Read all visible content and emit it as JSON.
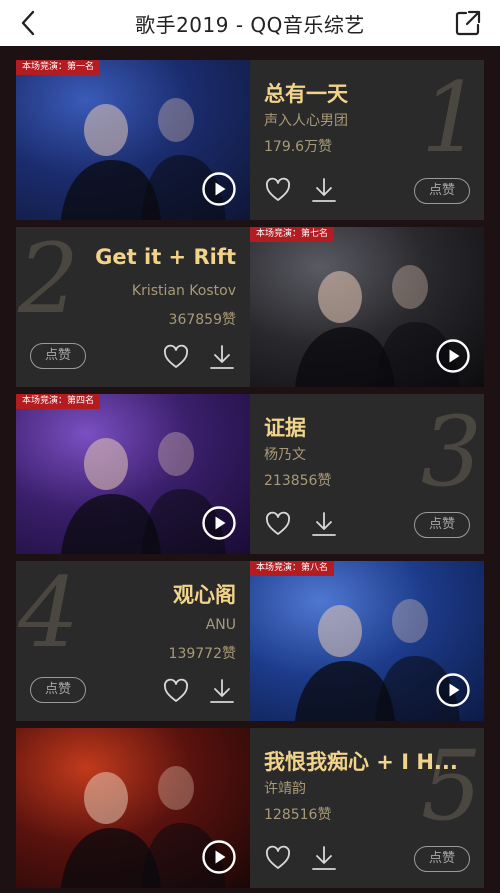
{
  "header": {
    "title": "歌手2019 - QQ音乐综艺"
  },
  "cards": [
    {
      "rank": "1",
      "song": "总有一天",
      "artist": "声入人心男团",
      "likes": "179.6万赞",
      "tag": "本场竞演：第一名",
      "layout": "left-photo",
      "colors": [
        "#1b2c6e",
        "#0e1636",
        "#3a5bb8"
      ]
    },
    {
      "rank": "2",
      "song": "Get it + Rift",
      "artist": "Kristian Kostov",
      "likes": "367859赞",
      "tag": "本场竞演：第七名",
      "layout": "right-photo",
      "colors": [
        "#2a2a2e",
        "#0c0c0f",
        "#5a5a63"
      ]
    },
    {
      "rank": "3",
      "song": "证据",
      "artist": "杨乃文",
      "likes": "213856赞",
      "tag": "本场竞演：第四名",
      "layout": "left-photo",
      "colors": [
        "#3a1f6b",
        "#190b35",
        "#7b4fc2"
      ]
    },
    {
      "rank": "4",
      "song": "观心阁",
      "artist": "ANU",
      "likes": "139772赞",
      "tag": "本场竞演：第八名",
      "layout": "right-photo",
      "colors": [
        "#1d3b8a",
        "#0c1a45",
        "#4f78d2"
      ]
    },
    {
      "rank": "5",
      "song": "我恨我痴心 + I H...",
      "artist": "许靖韵",
      "likes": "128516赞",
      "tag": "",
      "layout": "left-photo",
      "colors": [
        "#5a120e",
        "#1a0706",
        "#c23a1c"
      ]
    }
  ],
  "labels": {
    "zan": "点赞"
  },
  "icons": {
    "back": "back-chevron-icon",
    "share": "share-icon",
    "play": "play-icon",
    "heart": "heart-icon",
    "download": "download-icon"
  }
}
